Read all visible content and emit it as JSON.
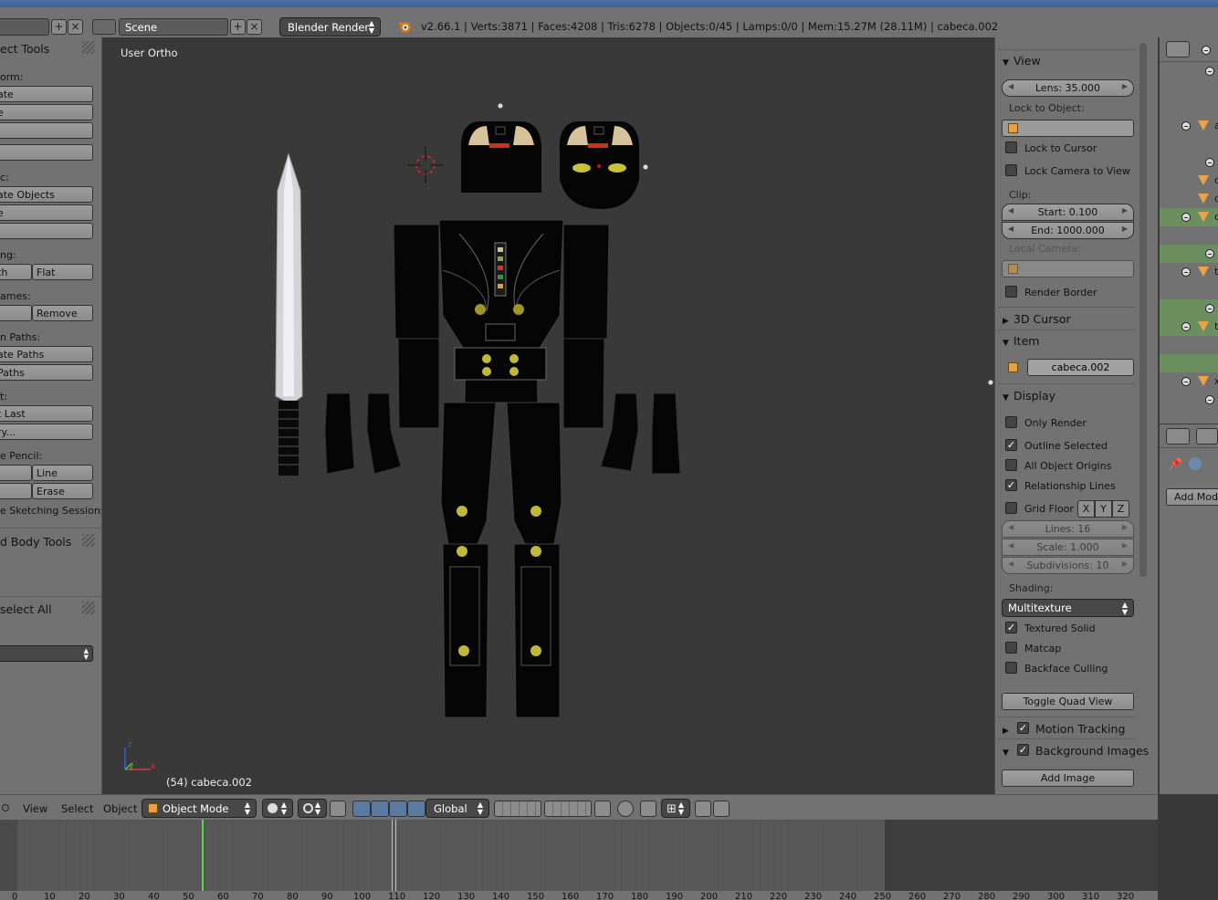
{
  "header": {
    "left_field": "",
    "scene": "Scene",
    "renderer": "Blender Render",
    "stats": "v2.66.1 | Verts:3871 | Faces:4208 | Tris:6278 | Objects:0/45 | Lamps:0/0 | Mem:15.27M (28.11M) | cabeca.002"
  },
  "toolshelf": {
    "title": "ect Tools",
    "transform_label": "orm:",
    "transform_buttons": [
      "ate",
      "e",
      ""
    ],
    "extra_button": "",
    "edit_label": "c:",
    "edit_buttons": [
      "ate Objects",
      "e",
      ""
    ],
    "shading_label": "ng:",
    "shading_buttons": [
      "th",
      "Flat"
    ],
    "keyframes_label": "ames:",
    "keyframes_buttons": [
      "",
      "Remove"
    ],
    "motion_label": "n Paths:",
    "motion_buttons": [
      "ate Paths",
      "Paths"
    ],
    "repeat_label": "t:",
    "repeat_buttons": [
      "t Last",
      "ry..."
    ],
    "grease_label": "e Pencil:",
    "grease_buttons": [
      "",
      "Line",
      "",
      "Erase"
    ],
    "sketch_label": "e Sketching Sessions",
    "rigid_title": "d Body Tools",
    "select_title": "select All",
    "select_dropdown": ""
  },
  "viewport": {
    "view_label": "User Ortho",
    "object_label": "(54) cabeca.002"
  },
  "properties": {
    "view_title": "View",
    "lens": "Lens: 35.000",
    "lock_object_label": "Lock to Object:",
    "lock_cursor": "Lock to Cursor",
    "lock_camera": "Lock Camera to View",
    "clip_label": "Clip:",
    "clip_start": "Start: 0.100",
    "clip_end": "End: 1000.000",
    "local_camera": "Local Camera:",
    "render_border": "Render Border",
    "cursor_title": "3D Cursor",
    "item_title": "Item",
    "item_name": "cabeca.002",
    "display_title": "Display",
    "only_render": "Only Render",
    "outline_selected": "Outline Selected",
    "all_origins": "All Object Origins",
    "relationship_lines": "Relationship Lines",
    "grid_floor": "Grid Floor",
    "axis_x": "X",
    "axis_y": "Y",
    "axis_z": "Z",
    "lines": "Lines: 16",
    "scale": "Scale: 1.000",
    "subdivisions": "Subdivisions: 10",
    "shading_label": "Shading:",
    "shading_value": "Multitexture",
    "textured_solid": "Textured Solid",
    "matcap": "Matcap",
    "backface": "Backface Culling",
    "quad_view": "Toggle Quad View",
    "motion_tracking": "Motion Tracking",
    "background_images": "Background Images",
    "add_image": "Add Image"
  },
  "checks": {
    "lock_cursor": false,
    "lock_camera": false,
    "render_border": false,
    "only_render": false,
    "outline_selected": true,
    "all_origins": false,
    "relationship_lines": true,
    "grid_floor": false,
    "textured_solid": true,
    "matcap": false,
    "backface": false,
    "motion_tracking": true,
    "background_images": true
  },
  "outliner": {
    "rows": [
      "",
      "",
      "a",
      "",
      "c",
      "c",
      "c",
      "",
      "t",
      "",
      "t",
      "",
      "x",
      ""
    ]
  },
  "prop_editor": {
    "add_modifier": "Add Modifi"
  },
  "viewport_header": {
    "view_menu": "View",
    "select_menu": "Select",
    "object_menu": "Object",
    "mode": "Object Mode",
    "orientation": "Global"
  },
  "timeline": {
    "ticks": [
      "0",
      "10",
      "20",
      "30",
      "40",
      "50",
      "60",
      "70",
      "80",
      "90",
      "100",
      "110",
      "120",
      "130",
      "140",
      "150",
      "160",
      "170",
      "180",
      "190",
      "200",
      "210",
      "220",
      "230",
      "240",
      "250",
      "260",
      "270",
      "280",
      "290",
      "300",
      "310",
      "320"
    ],
    "current_frame": 54,
    "keyframes": [
      110,
      111
    ]
  },
  "colors": {
    "accent_green": "#5bd650",
    "key_yellow": "#d8d050",
    "panel_bg": "#727272",
    "viewport_bg": "#393939"
  }
}
